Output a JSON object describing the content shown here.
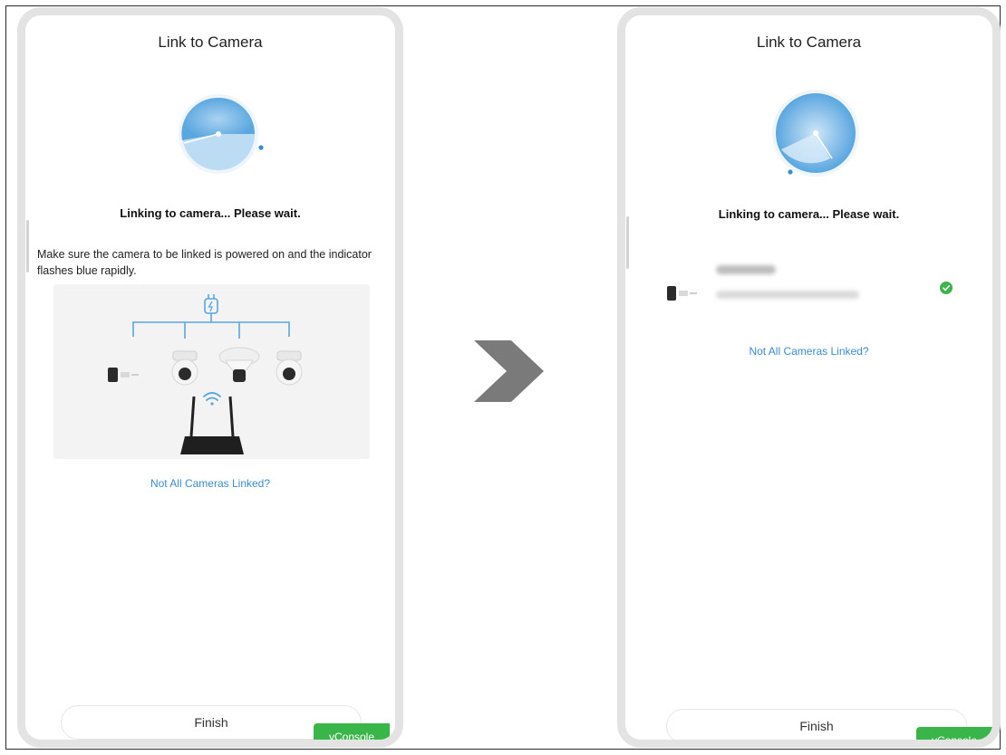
{
  "left_screen": {
    "title": "Link to Camera",
    "status": "Linking to camera... Please wait.",
    "hint": "Make sure the camera to be linked is powered on and the indicator flashes blue rapidly.",
    "not_linked_link": "Not All Cameras Linked?",
    "finish_label": "Finish",
    "vconsole_label": "vConsole"
  },
  "right_screen": {
    "title": "Link to Camera",
    "status": "Linking to camera... Please wait.",
    "device": {
      "icon": "bullet-camera-icon",
      "status_icon": "check-circle-icon"
    },
    "not_linked_link": "Not All Cameras Linked?",
    "finish_label": "Finish",
    "vconsole_label": "vConsole"
  },
  "colors": {
    "accent_blue": "#3a8bd2",
    "radar_blue": "#5aa6e0",
    "success_green": "#39b54a"
  }
}
